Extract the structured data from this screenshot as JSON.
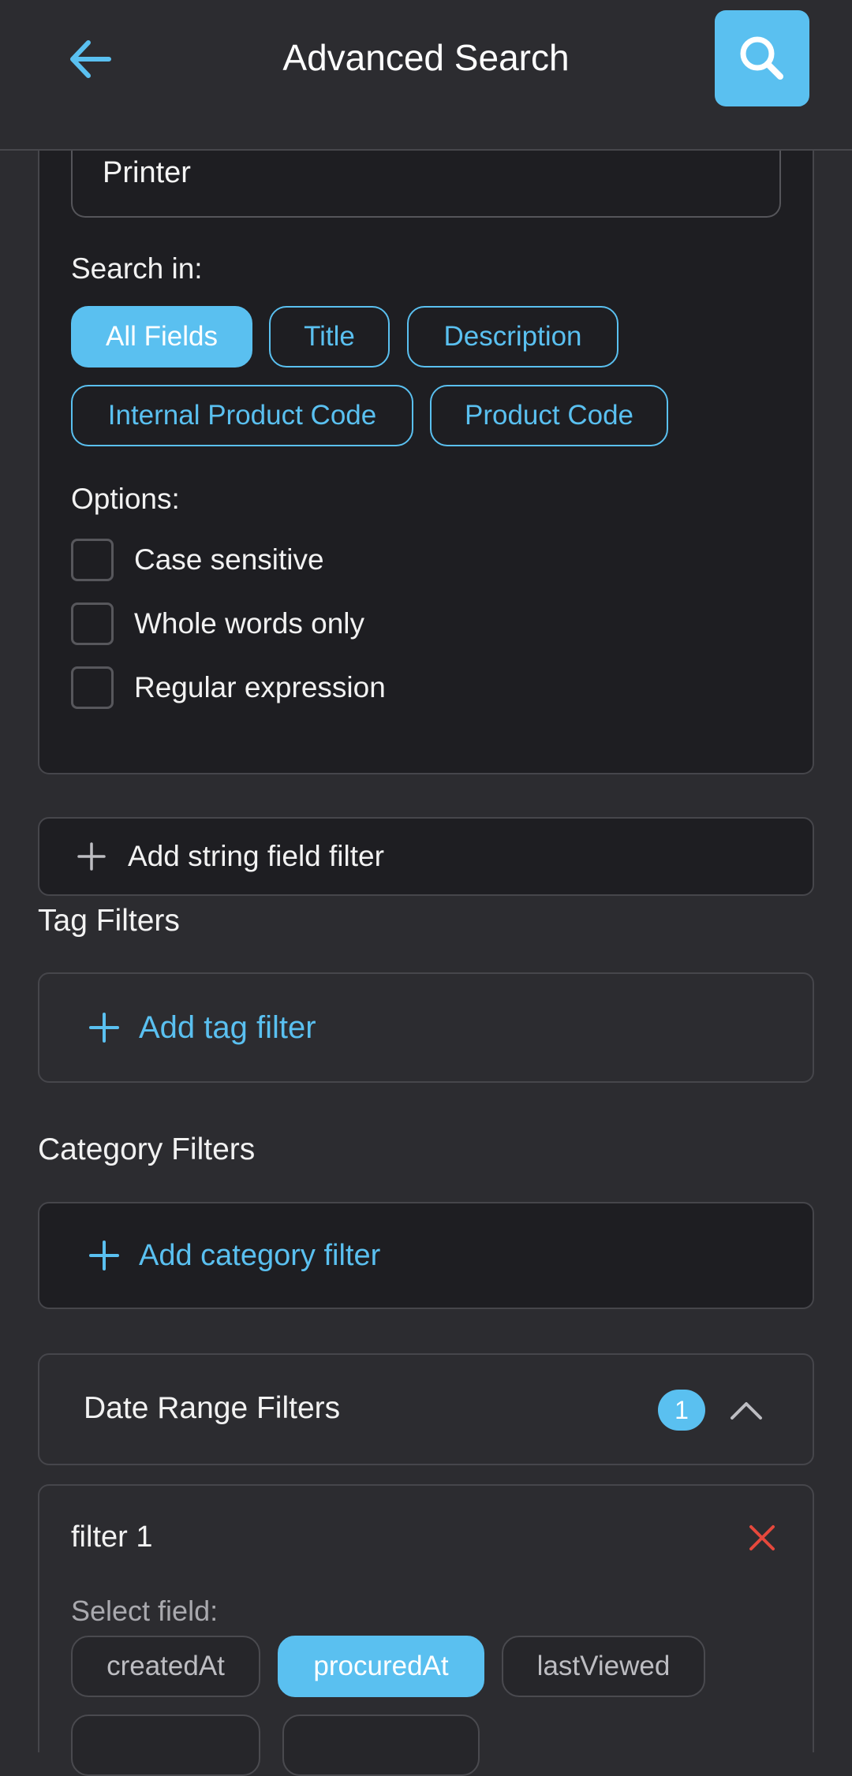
{
  "header": {
    "title": "Advanced Search"
  },
  "search": {
    "value": "Printer"
  },
  "search_in": {
    "label": "Search in:",
    "chips": [
      "All Fields",
      "Title",
      "Description",
      "Internal Product Code",
      "Product Code"
    ],
    "selected": "All Fields"
  },
  "options": {
    "label": "Options:",
    "items": [
      "Case sensitive",
      "Whole words only",
      "Regular expression"
    ]
  },
  "string_filter": {
    "add_label": "Add string field filter"
  },
  "tag_filters": {
    "title": "Tag Filters",
    "add_label": "Add tag filter"
  },
  "category_filters": {
    "title": "Category Filters",
    "add_label": "Add category filter"
  },
  "date_range": {
    "title": "Date Range Filters",
    "count": "1",
    "filter": {
      "name": "filter 1",
      "select_label": "Select field:",
      "fields": [
        "createdAt",
        "procuredAt",
        "lastViewed"
      ],
      "selected": "procuredAt"
    }
  },
  "colors": {
    "accent": "#5ac0f0",
    "remove": "#e5483c",
    "panel": "#1e1e22",
    "background": "#2c2c30"
  }
}
